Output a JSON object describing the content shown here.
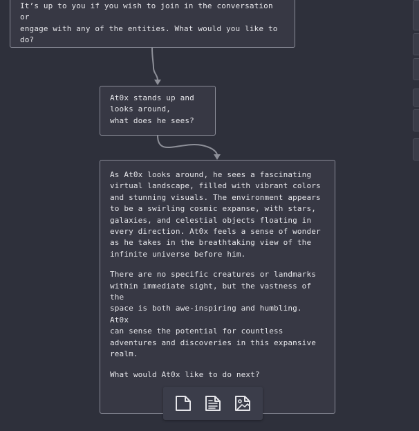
{
  "nodes": {
    "top": {
      "text": "It’s up to you if you wish to join in the conversation or\nengage with any of the entities. What would you like to\ndo?"
    },
    "query": {
      "text": "At0x stands up and\nlooks around,\nwhat does he sees?"
    },
    "response": {
      "paragraphs": [
        "As At0x looks around, he sees a fascinating\nvirtual landscape, filled with vibrant colors\nand stunning visuals. The environment appears\nto be a swirling cosmic expanse, with stars,\ngalaxies, and celestial objects floating in\nevery direction. At0x feels a sense of wonder\nas he takes in the breathtaking view of the\ninfinite universe before him.",
        "There are no specific creatures or landmarks\nwithin immediate sight, but the vastness of the\nspace is both awe-inspiring and humbling. At0x\ncan sense the potential for countless\nadventures and discoveries in this expansive\nrealm.",
        "What would At0x like to do next?"
      ]
    }
  },
  "toolbar": {
    "buttons": [
      {
        "icon": "blank-document-icon"
      },
      {
        "icon": "text-document-icon"
      },
      {
        "icon": "image-document-icon"
      }
    ]
  },
  "colors": {
    "background": "#2e303b",
    "node_fill": "#373844",
    "node_border": "#8a8c98",
    "connector": "#8e9099",
    "text": "#e6e6ea"
  }
}
